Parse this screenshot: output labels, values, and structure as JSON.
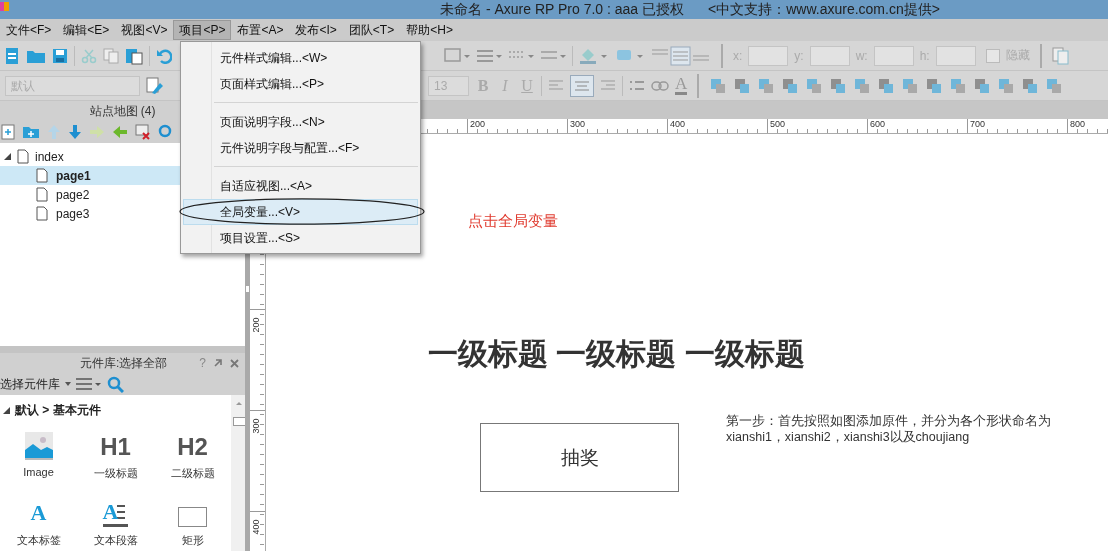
{
  "window": {
    "title": "未命名 - Axure RP Pro 7.0 : aaa 已授权",
    "support": "<中文支持：www.axure.com.cn提供>"
  },
  "menu_bar": [
    {
      "label": "文件<F>",
      "selected": false
    },
    {
      "label": "编辑<E>",
      "selected": false
    },
    {
      "label": "视图<V>",
      "selected": false
    },
    {
      "label": "项目<P>",
      "selected": true
    },
    {
      "label": "布置<A>",
      "selected": false
    },
    {
      "label": "发布<I>",
      "selected": false
    },
    {
      "label": "团队<T>",
      "selected": false
    },
    {
      "label": "帮助<H>",
      "selected": false
    }
  ],
  "project_menu": {
    "items": [
      {
        "kind": "item",
        "label": "元件样式编辑...<W>",
        "selected": false
      },
      {
        "kind": "item",
        "label": "页面样式编辑...<P>",
        "selected": false
      },
      {
        "kind": "separator"
      },
      {
        "kind": "item",
        "label": "页面说明字段...<N>",
        "selected": false
      },
      {
        "kind": "item",
        "label": "元件说明字段与配置...<F>",
        "selected": false
      },
      {
        "kind": "separator"
      },
      {
        "kind": "item",
        "label": "自适应视图...<A>",
        "selected": false
      },
      {
        "kind": "item",
        "label": "全局变量...<V>",
        "selected": true
      },
      {
        "kind": "item",
        "label": "项目设置...<S>",
        "selected": false
      }
    ]
  },
  "toolbar": {
    "font_family": "默认",
    "font_size": "13",
    "format_buttons": [
      "B",
      "I",
      "U"
    ],
    "font_color_glyph": "A",
    "position_fields": [
      {
        "label": "x:"
      },
      {
        "label": "y:"
      },
      {
        "label": "w:"
      },
      {
        "label": "h:"
      }
    ],
    "hidden_checkbox": {
      "label": "隐藏",
      "checked": false
    }
  },
  "sitemap": {
    "title": "站点地图 (4)",
    "tree": [
      {
        "label": "index",
        "expanded": true,
        "selected": false,
        "children": [
          {
            "label": "page1",
            "selected": true
          },
          {
            "label": "page2",
            "selected": false
          },
          {
            "label": "page3",
            "selected": false
          }
        ]
      }
    ]
  },
  "widget_library": {
    "title": "元件库:选择全部",
    "help": "?",
    "library_select": "选择元件库",
    "group": {
      "label": "默认 > 基本元件",
      "expanded": true
    },
    "widgets": [
      {
        "kind": "image",
        "label": "Image"
      },
      {
        "kind": "h1",
        "glyph": "H1",
        "label": "一级标题"
      },
      {
        "kind": "h2",
        "glyph": "H2",
        "label": "二级标题"
      },
      {
        "kind": "text-label",
        "glyph": "A",
        "label": "文本标签"
      },
      {
        "kind": "paragraph",
        "glyph": "A",
        "label": "文本段落"
      },
      {
        "kind": "rectangle",
        "label": "矩形"
      }
    ]
  },
  "rulers": {
    "horizontal": [
      "200",
      "300",
      "400",
      "500",
      "600",
      "700",
      "800"
    ],
    "vertical": [
      "200",
      "300",
      "400"
    ]
  },
  "canvas": {
    "annotation": "点击全局变量",
    "heading": "一级标题 一级标题 一级标题",
    "button": "抽奖",
    "note": "第一步：首先按照如图添加原件，并分为各个形状命名为xianshi1，xianshi2，xianshi3以及choujiang"
  }
}
